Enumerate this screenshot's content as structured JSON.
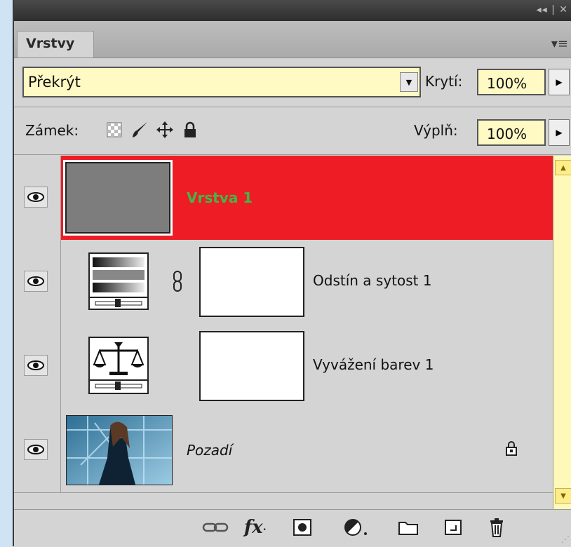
{
  "panel": {
    "tab_label": "Vrstvy",
    "titlebar_controls": "◂◂ | ✕",
    "menu_icon": "panel-menu-icon"
  },
  "options": {
    "blend_mode": "Překrýt",
    "opacity_label": "Krytí:",
    "opacity_value": "100%",
    "lock_label": "Zámek:",
    "fill_label": "Výplň:",
    "fill_value": "100%"
  },
  "layers": [
    {
      "name": "Vrstva 1",
      "visible": true,
      "selected": true,
      "type": "pixel-gray",
      "name_color": "#41b649"
    },
    {
      "name": "Odstín a sytost 1",
      "visible": true,
      "selected": false,
      "type": "hue-saturation-adjustment"
    },
    {
      "name": "Vyvážení barev 1",
      "visible": true,
      "selected": false,
      "type": "color-balance-adjustment"
    },
    {
      "name": "Pozadí",
      "visible": true,
      "selected": false,
      "type": "background-photo",
      "locked": true
    }
  ],
  "bottom_icons": [
    "link-layers-icon",
    "fx-icon",
    "layer-mask-icon",
    "adjustment-layer-icon",
    "group-folder-icon",
    "new-layer-icon",
    "trash-icon"
  ],
  "colors": {
    "selected_row": "#ee1c25",
    "field_bg": "#fff9c4",
    "panel_bg": "#d4d4d4"
  }
}
